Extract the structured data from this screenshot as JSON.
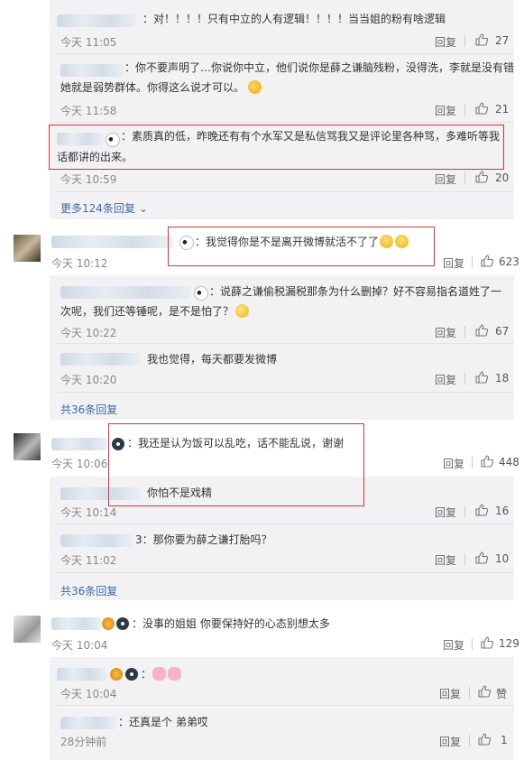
{
  "comments": [
    {
      "id": "c1",
      "text": "：对！！！！只有中立的人有逻辑！！！！当当姐的粉有啥逻辑",
      "time": "今天 11:05",
      "reply": "回复",
      "likes": "27"
    },
    {
      "id": "c2",
      "text_line1": "：你不要声明了…你说你中立，他们说你是薛之谦脑残粉，没得洗，李就是没有错",
      "text_line2": "她就是弱势群体。你得这么说才可以。",
      "time": "今天 11:58",
      "reply": "回复",
      "likes": "21"
    },
    {
      "id": "c3",
      "text_line1": "：素质真的低，昨晚还有有个水军又是私信骂我又是评论里各种骂，多难听等我",
      "text_line2": "话都讲的出来。",
      "time": "今天 10:59",
      "reply": "回复",
      "likes": "20"
    },
    {
      "id": "more1",
      "text": "更多124条回复"
    },
    {
      "id": "c4",
      "text": "：我觉得你是不是离开微博就活不了了",
      "time": "今天 10:12",
      "reply": "回复",
      "likes": "623"
    },
    {
      "id": "c5",
      "text_line1": "：说薛之谦偷税漏税那条为什么删掉？好不容易指名道姓了一",
      "text_line2": "次呢，我们还等锤呢，是不是怕了？",
      "time": "今天 10:22",
      "reply": "回复",
      "likes": "67"
    },
    {
      "id": "c6",
      "text": "我也觉得，每天都要发微博",
      "time": "今天 10:20",
      "reply": "回复",
      "likes": "18"
    },
    {
      "id": "more2",
      "text": "共36条回复"
    },
    {
      "id": "c7",
      "text": "：我还是认为饭可以乱吃，话不能乱说，谢谢",
      "time": "今天 10:06",
      "reply": "回复",
      "likes": "448"
    },
    {
      "id": "c8",
      "text": "你怕不是戏精",
      "time": "今天 10:14",
      "reply": "回复",
      "likes": "16"
    },
    {
      "id": "c9",
      "text_prefix": "3",
      "text": "：那你要为薛之谦打胎吗？",
      "time": "今天 11:02",
      "reply": "回复",
      "likes": "10"
    },
    {
      "id": "more3",
      "text": "共36条回复"
    },
    {
      "id": "c10",
      "text": "：没事的姐姐 你要保持好的心态别想太多",
      "time": "今天 10:04",
      "reply": "回复",
      "likes": "129"
    },
    {
      "id": "c11",
      "text": "：",
      "time": "今天 10:04",
      "reply": "回复",
      "likes": "赞"
    },
    {
      "id": "c12",
      "text": "：还真是个 弟弟哎",
      "time": "28分钟前",
      "reply": "回复",
      "likes": "1"
    }
  ],
  "colors": {
    "highlight_border": "#e0302f",
    "link": "#3b6aa6",
    "panel_bg": "#f2f2f5"
  }
}
